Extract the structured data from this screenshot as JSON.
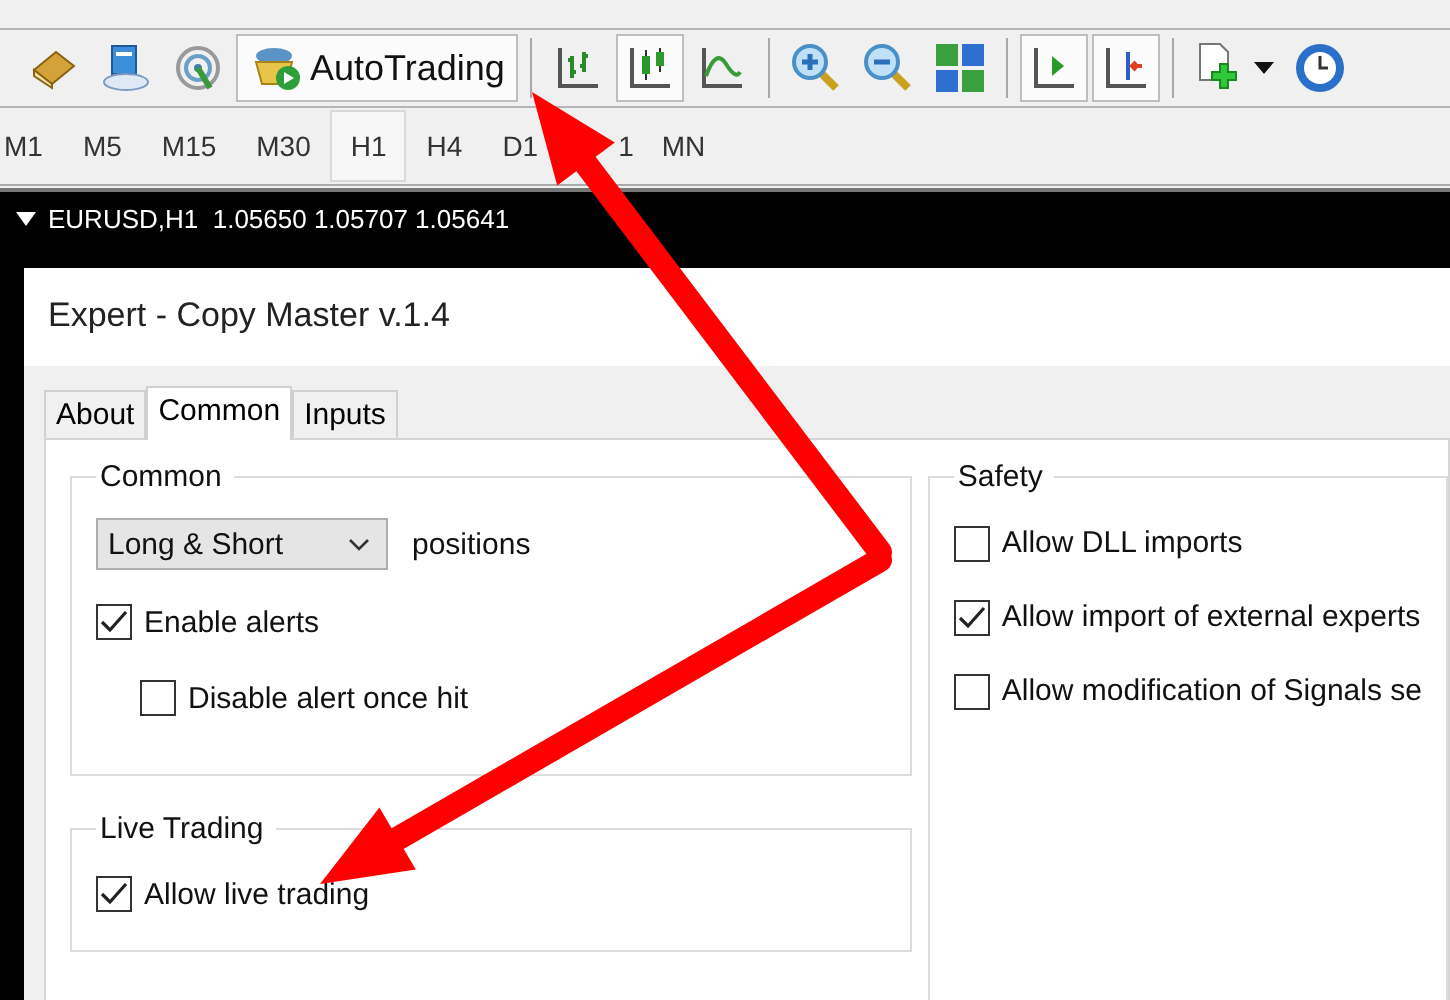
{
  "toolbar": {
    "autotrading_label": "AutoTrading",
    "tools": [
      {
        "kind": "book",
        "pressed": false
      },
      {
        "kind": "cloud",
        "pressed": false
      },
      {
        "kind": "signal",
        "pressed": false
      },
      {
        "kind": "autotrading",
        "pressed": true
      },
      {
        "kind": "sep"
      },
      {
        "kind": "bars",
        "pressed": false
      },
      {
        "kind": "candles",
        "pressed": true
      },
      {
        "kind": "line",
        "pressed": false
      },
      {
        "kind": "sep"
      },
      {
        "kind": "zoomin",
        "pressed": false
      },
      {
        "kind": "zoomout",
        "pressed": false
      },
      {
        "kind": "tile",
        "pressed": false
      },
      {
        "kind": "sep"
      },
      {
        "kind": "shift",
        "pressed": true
      },
      {
        "kind": "autoscroll",
        "pressed": true
      },
      {
        "kind": "sep"
      },
      {
        "kind": "newdoc",
        "pressed": false
      },
      {
        "kind": "clock",
        "pressed": false
      }
    ]
  },
  "timeframes": [
    {
      "label": "M1",
      "selected": false
    },
    {
      "label": "M5",
      "selected": false
    },
    {
      "label": "M15",
      "selected": false
    },
    {
      "label": "M30",
      "selected": false
    },
    {
      "label": "H1",
      "selected": true
    },
    {
      "label": "H4",
      "selected": false
    },
    {
      "label": "D1",
      "selected": false
    },
    {
      "label": "1",
      "selected": false
    },
    {
      "label": "MN",
      "selected": false
    }
  ],
  "chart": {
    "header": "EURUSD,H1  1.05650 1.05707 1.05641"
  },
  "dialog": {
    "title": "Expert - Copy Master v.1.4",
    "tabs": [
      {
        "label": "About",
        "selected": false
      },
      {
        "label": "Common",
        "selected": true
      },
      {
        "label": "Inputs",
        "selected": false
      }
    ],
    "common": {
      "title": "Common",
      "dropdown": "Long & Short",
      "dropdown_suffix": "positions",
      "options": [
        {
          "label": "Enable alerts",
          "checked": true,
          "indented": false
        },
        {
          "label": "Disable alert once hit",
          "checked": false,
          "indented": true
        }
      ]
    },
    "live_trading": {
      "title": "Live Trading",
      "options": [
        {
          "label": "Allow live trading",
          "checked": true
        }
      ]
    },
    "safety": {
      "title": "Safety",
      "options": [
        {
          "label": "Allow DLL imports",
          "checked": false
        },
        {
          "label": "Allow import of external experts",
          "checked": true
        },
        {
          "label": "Allow modification of Signals se",
          "checked": false
        }
      ]
    }
  }
}
